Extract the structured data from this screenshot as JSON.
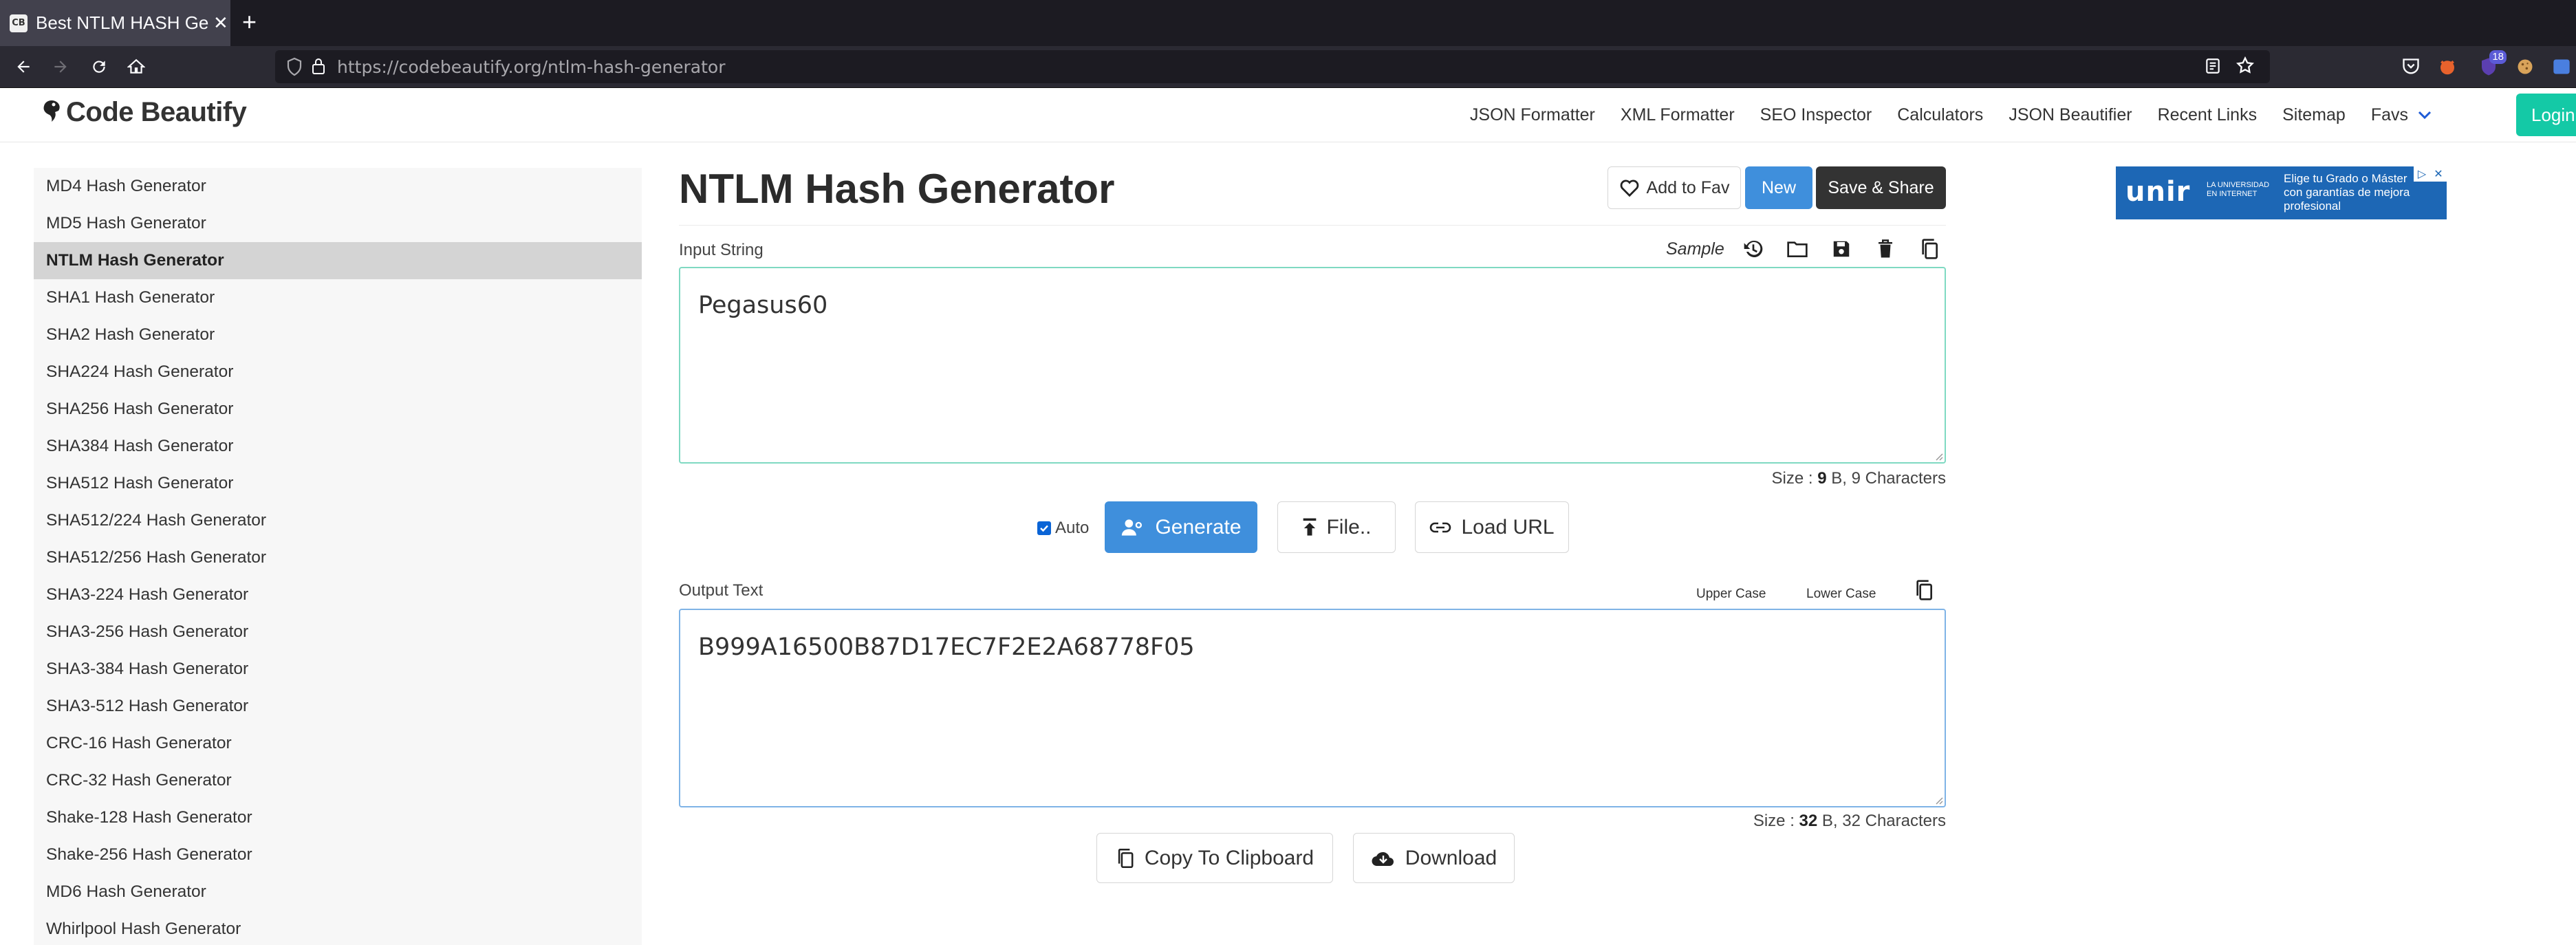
{
  "browser": {
    "tab_title": "Best NTLM HASH Generator",
    "tab_favicon": "CB",
    "url_host": "https://codebeautify.org",
    "url_path": "/ntlm-hash-generator",
    "extension_badge": "18"
  },
  "site": {
    "logo": "Code Beautify",
    "nav": [
      "JSON Formatter",
      "XML Formatter",
      "SEO Inspector",
      "Calculators",
      "JSON Beautifier",
      "Recent Links",
      "Sitemap"
    ],
    "favs_label": "Favs",
    "login_label": "Login"
  },
  "sidebar": {
    "items": [
      "MD4 Hash Generator",
      "MD5 Hash Generator",
      "NTLM Hash Generator",
      "SHA1 Hash Generator",
      "SHA2 Hash Generator",
      "SHA224 Hash Generator",
      "SHA256 Hash Generator",
      "SHA384 Hash Generator",
      "SHA512 Hash Generator",
      "SHA512/224 Hash Generator",
      "SHA512/256 Hash Generator",
      "SHA3-224 Hash Generator",
      "SHA3-256 Hash Generator",
      "SHA3-384 Hash Generator",
      "SHA3-512 Hash Generator",
      "CRC-16 Hash Generator",
      "CRC-32 Hash Generator",
      "Shake-128 Hash Generator",
      "Shake-256 Hash Generator",
      "MD6 Hash Generator",
      "Whirlpool Hash Generator"
    ],
    "active_item": "NTLM Hash Generator"
  },
  "main": {
    "title": "NTLM Hash Generator",
    "add_fav_label": "Add to Fav",
    "new_label": "New",
    "save_share_label": "Save & Share",
    "input_label": "Input String",
    "sample_label": "Sample",
    "input_value": "Pegasus60",
    "input_size": {
      "prefix": "Size : ",
      "bytes": "9",
      "suffix": " B, 9 Characters"
    },
    "auto_label": "Auto",
    "auto_checked": true,
    "generate_label": "Generate",
    "file_label": "File..",
    "load_url_label": "Load URL",
    "output_label": "Output Text",
    "upper_case_label": "Upper Case",
    "lower_case_label": "Lower Case",
    "output_value": "B999A16500B87D17EC7F2E2A68778F05",
    "output_size": {
      "prefix": "Size : ",
      "bytes": "32",
      "suffix": " B, 32 Characters"
    },
    "copy_label": "Copy To Clipboard",
    "download_label": "Download"
  },
  "ad": {
    "logo": "unir",
    "logo_sub_1": "LA UNIVERSIDAD",
    "logo_sub_2": "EN INTERNET",
    "headline": "Elige tu Grado o Máster",
    "body": "con garantías de mejora profesional"
  },
  "colors": {
    "accent_teal": "#14c9a6",
    "button_blue": "#3f8fdc",
    "button_dark": "#333333",
    "sidebar_active": "#d4d4d4"
  }
}
